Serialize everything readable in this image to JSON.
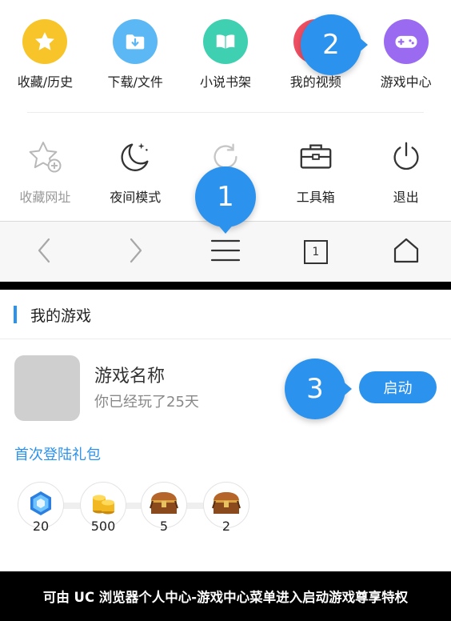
{
  "menu": {
    "row1": [
      {
        "label": "收藏/历史",
        "icon": "star-icon",
        "color": "#f7c42a"
      },
      {
        "label": "下载/文件",
        "icon": "download-folder-icon",
        "color": "#5bb8f5"
      },
      {
        "label": "小说书架",
        "icon": "book-icon",
        "color": "#3ed0b0"
      },
      {
        "label": "我的视频",
        "icon": "video-icon",
        "color": "#f04f62"
      },
      {
        "label": "游戏中心",
        "icon": "gamepad-icon",
        "color": "#9a6bf1"
      }
    ],
    "row2": [
      {
        "label": "收藏网址",
        "icon": "star-add-icon",
        "disabled": true
      },
      {
        "label": "夜间模式",
        "icon": "moon-icon"
      },
      {
        "label": "",
        "icon": "refresh-icon"
      },
      {
        "label": "工具箱",
        "icon": "toolbox-icon"
      },
      {
        "label": "退出",
        "icon": "power-icon"
      }
    ]
  },
  "navbar": {
    "items": [
      "back-arrow-icon",
      "forward-arrow-icon",
      "menu-icon",
      "tabs-icon",
      "home-icon"
    ],
    "tab_count": "1"
  },
  "callouts": {
    "b1": "1",
    "b2": "2",
    "b3": "3"
  },
  "games": {
    "section_title": "我的游戏",
    "game_name": "游戏名称",
    "played": "你已经玩了25天",
    "launch_label": "启动",
    "gift_link": "首次登陆礼包",
    "rewards": [
      {
        "icon": "blue-gem-icon",
        "count": "20"
      },
      {
        "icon": "gold-coins-icon",
        "count": "500"
      },
      {
        "icon": "treasure-chest-icon",
        "count": "5"
      },
      {
        "icon": "treasure-chest-icon",
        "count": "2"
      }
    ]
  },
  "caption": "可由 UC 浏览器个人中心-游戏中心菜单进入启动游戏尊享特权",
  "colors": {
    "accent": "#2b93ee",
    "thumb_placeholder": "#cfcfcf"
  }
}
